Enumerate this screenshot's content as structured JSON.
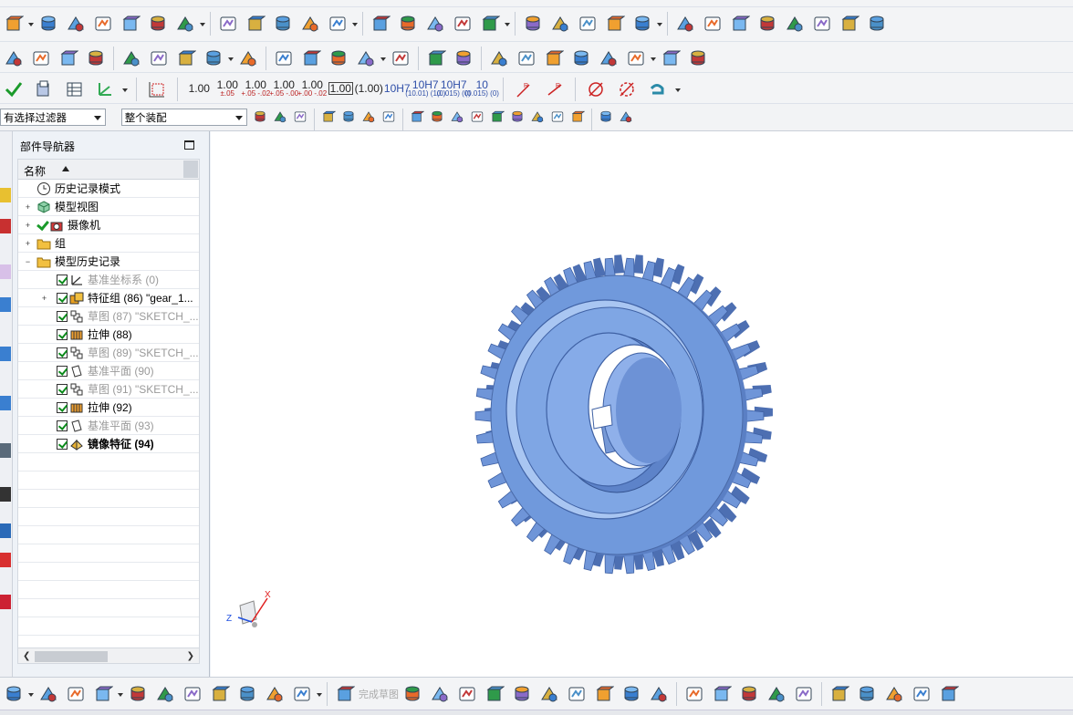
{
  "toolbar": {
    "row1_icons": [
      "sketch-icon",
      "extrude-icon",
      "revolve-icon",
      "block-icon",
      "cylinder-icon",
      "hole-icon",
      "boss-icon",
      "emboss-icon",
      "pattern-icon",
      "unite-icon",
      "shape-icon",
      "blend-icon",
      "chamfer-icon",
      "shell-icon",
      "draft-icon",
      "trim-body-icon",
      "offset-face-icon",
      "thicken-icon",
      "sweep-icon",
      "curve-mesh-icon",
      "ruled-icon",
      "studio-surface-icon",
      "sew-icon",
      "section-icon",
      "surface-icon",
      "face-blend-icon",
      "sheet-icon",
      "bridge-icon",
      "styled-blend-icon",
      "swoop-icon"
    ],
    "row2_icons": [
      "datum-csys-icon",
      "layer-icon",
      "stack-icon",
      "label-icon",
      "move-face-icon",
      "replace-face-icon",
      "offset-region-icon",
      "text-icon",
      "symbol-icon",
      "wave-icon",
      "section-view-icon",
      "thread-icon",
      "spring-icon",
      "washer-icon",
      "deform-icon",
      "triangle-icon",
      "table-icon",
      "add-icon",
      "part-family-icon",
      "note-icon",
      "pmi-icon",
      "fit-tolerance-icon",
      "assembly-icon",
      "component-icon"
    ],
    "tolerance_buttons": [
      {
        "main": "1.00",
        "sub": ""
      },
      {
        "main": "1.00",
        "sub": "±.05"
      },
      {
        "main": "1.00",
        "sub": "+.05 -.02"
      },
      {
        "main": "1.00",
        "sub": "+.05 -.00"
      },
      {
        "main": "1.00",
        "sub": "+.00 -.02"
      },
      {
        "main": "1.00",
        "sub": "boxed"
      },
      {
        "main": "(1.00)",
        "sub": ""
      },
      {
        "main": "10H7",
        "sub": ""
      },
      {
        "main": "10H7",
        "sub": "(10.01) (10.)"
      },
      {
        "main": "10H7",
        "sub": "(0.015) (0)"
      },
      {
        "main": "10",
        "sub": "(0.015) (0)"
      }
    ],
    "fit_label": "10H7",
    "filter_select": "有选择过滤器",
    "scope_select": "整个装配"
  },
  "navigator": {
    "title": "部件导航器",
    "column_name": "名称",
    "rows": [
      {
        "label": "历史记录模式",
        "icon": "clock-icon",
        "expand": "",
        "check": "none",
        "grey": false,
        "bold": false,
        "indent": 0
      },
      {
        "label": "模型视图",
        "icon": "model-view-icon",
        "expand": "+",
        "check": "none",
        "grey": false,
        "bold": false,
        "indent": 0
      },
      {
        "label": "摄像机",
        "icon": "camera-icon",
        "expand": "+",
        "check": "green",
        "grey": false,
        "bold": false,
        "indent": 0
      },
      {
        "label": "组",
        "icon": "folder-icon",
        "expand": "+",
        "check": "none",
        "grey": false,
        "bold": false,
        "indent": 0
      },
      {
        "label": "模型历史记录",
        "icon": "folder-open-icon",
        "expand": "−",
        "check": "none",
        "grey": false,
        "bold": false,
        "indent": 0
      },
      {
        "label": "基准坐标系 (0)",
        "icon": "datum-csys-icon",
        "expand": "",
        "check": "box",
        "grey": true,
        "bold": false,
        "indent": 1
      },
      {
        "label": "特征组 (86) \"gear_1...",
        "icon": "feature-group-icon",
        "expand": "+",
        "check": "box",
        "grey": false,
        "bold": false,
        "indent": 1
      },
      {
        "label": "草图 (87) \"SKETCH_...",
        "icon": "sketch-icon",
        "expand": "",
        "check": "box",
        "grey": true,
        "bold": false,
        "indent": 1
      },
      {
        "label": "拉伸 (88)",
        "icon": "extrude-icon",
        "expand": "",
        "check": "box",
        "grey": false,
        "bold": false,
        "indent": 1
      },
      {
        "label": "草图 (89) \"SKETCH_...",
        "icon": "sketch-icon",
        "expand": "",
        "check": "box",
        "grey": true,
        "bold": false,
        "indent": 1
      },
      {
        "label": "基准平面 (90)",
        "icon": "datum-plane-icon",
        "expand": "",
        "check": "box",
        "grey": true,
        "bold": false,
        "indent": 1
      },
      {
        "label": "草图 (91) \"SKETCH_...",
        "icon": "sketch-icon",
        "expand": "",
        "check": "box",
        "grey": true,
        "bold": false,
        "indent": 1
      },
      {
        "label": "拉伸 (92)",
        "icon": "extrude-icon",
        "expand": "",
        "check": "box",
        "grey": false,
        "bold": false,
        "indent": 1
      },
      {
        "label": "基准平面 (93)",
        "icon": "datum-plane-icon",
        "expand": "",
        "check": "box",
        "grey": true,
        "bold": false,
        "indent": 1
      },
      {
        "label": "镜像特征 (94)",
        "icon": "mirror-icon",
        "expand": "",
        "check": "box",
        "grey": false,
        "bold": true,
        "indent": 1
      }
    ]
  },
  "viewport": {
    "model": "spur-gear",
    "tooth_count": 42,
    "model_color": "#6f95d8",
    "triad": {
      "x_label": "X",
      "z_label": "Z"
    }
  },
  "bottom_bar": {
    "finish_sketch_label": "完成草图",
    "icons": [
      "view-icon",
      "assembly-icon",
      "component-icon",
      "add-component-icon",
      "move-icon",
      "constraint-icon",
      "mirror-assembly-icon",
      "explode-icon",
      "pattern-component-icon",
      "wave-linker-icon",
      "render-icon",
      "finish-sketch-icon",
      "profile-icon",
      "line-icon",
      "arc-icon",
      "circle-icon",
      "fillet-icon",
      "chamfer-icon",
      "rectangle-icon",
      "polygon-icon",
      "point-icon",
      "studio-spline-icon",
      "quick-trim-icon",
      "quick-extend-icon",
      "make-corner-icon",
      "offset-curve-icon",
      "pattern-curve-icon",
      "mirror-curve-icon",
      "intersect-icon",
      "project-icon",
      "constraint-icon",
      "dimension-icon"
    ]
  },
  "colors": {
    "accent": "#2f6fc1",
    "gear": "#6f95d8",
    "gear_dark": "#3f61a4",
    "check_green": "#0a8a1a"
  }
}
